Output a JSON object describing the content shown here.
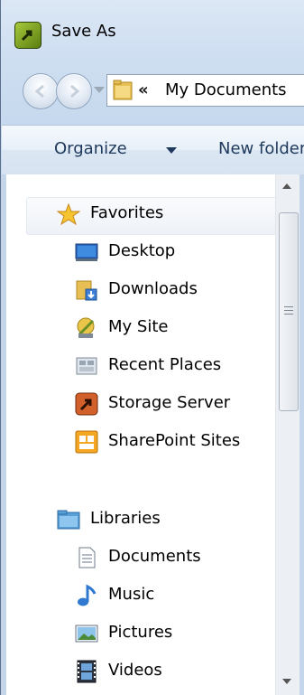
{
  "window": {
    "title": "Save As"
  },
  "address": {
    "chevron": "«",
    "path": "My Documents"
  },
  "toolbar": {
    "organize_label": "Organize",
    "new_folder_label": "New folder"
  },
  "nav": {
    "favorites": {
      "label": "Favorites",
      "items": [
        {
          "label": "Desktop",
          "icon": "desktop-icon"
        },
        {
          "label": "Downloads",
          "icon": "downloads-icon"
        },
        {
          "label": "My Site",
          "icon": "mysite-icon"
        },
        {
          "label": "Recent Places",
          "icon": "recent-places-icon"
        },
        {
          "label": "Storage Server",
          "icon": "storage-server-icon"
        },
        {
          "label": "SharePoint Sites",
          "icon": "sharepoint-icon"
        }
      ]
    },
    "libraries": {
      "label": "Libraries",
      "items": [
        {
          "label": "Documents",
          "icon": "documents-icon"
        },
        {
          "label": "Music",
          "icon": "music-icon"
        },
        {
          "label": "Pictures",
          "icon": "pictures-icon"
        },
        {
          "label": "Videos",
          "icon": "videos-icon"
        }
      ]
    }
  }
}
